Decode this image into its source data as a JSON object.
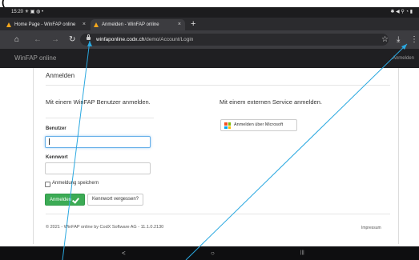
{
  "status_bar": {
    "time": "15:20",
    "left_icons": "☀ ▣ ◍ •",
    "right_icons": "✱ ◀ ⚲ ◔ ▮"
  },
  "tabs": [
    {
      "title": "Home Page - WinFAP online",
      "close": "×"
    },
    {
      "title": "Anmelden - WinFAP online",
      "close": "×"
    }
  ],
  "new_tab": "+",
  "toolbar": {
    "home_icon": "⌂",
    "back_icon": "←",
    "forward_icon": "→",
    "reload_icon": "↻",
    "url_domain": "winfaponline.codx.ch",
    "url_path": "/demo/Account/Login",
    "bookmark_icon": "☆",
    "download_icon": "⤓",
    "menu_icon": "⋮"
  },
  "site": {
    "brand": "WinFAP online",
    "signin": "Anmelden"
  },
  "page": {
    "title": "Anmelden",
    "local_heading": "Mit einem WinFAP Benutzer anmelden.",
    "user_label": "Benutzer",
    "user_value": "",
    "password_label": "Kennwort",
    "password_value": "",
    "remember_label": "Anmeldung speichern",
    "login_button": "Anmelden",
    "forgot_button": "Kennwort vergessen?",
    "external_heading": "Mit einem externen Service anmelden.",
    "microsoft_button": "Anmelden über Microsoft",
    "copyright": "© 2021 - WinFAP online by CodX Software AG - 11.1.0.2130",
    "impressum": "Impressum"
  },
  "nav_bar": {
    "back": "<",
    "home": "○",
    "recents": "|||"
  },
  "colors": {
    "accent_green": "#3cab55",
    "annotation_line": "#2aa8e0",
    "microsoft": [
      "#f25022",
      "#7fba00",
      "#00a4ef",
      "#ffb900"
    ]
  }
}
